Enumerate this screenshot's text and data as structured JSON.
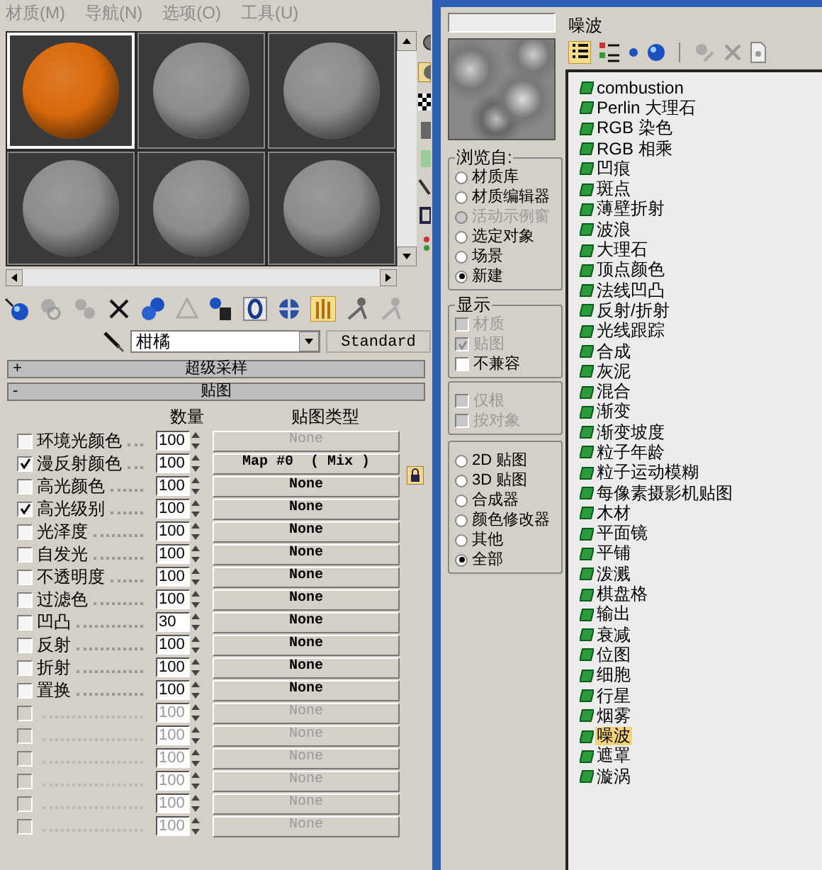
{
  "menu": [
    {
      "label": "材质(M)"
    },
    {
      "label": "导航(N)"
    },
    {
      "label": "选项(O)"
    },
    {
      "label": "工具(U)"
    }
  ],
  "sample_slots": [
    {
      "selected": true,
      "color": "#d8690c"
    },
    {
      "selected": false,
      "color": "#8c8c8c"
    },
    {
      "selected": false,
      "color": "#8c8c8c"
    },
    {
      "selected": false,
      "color": "#8c8c8c"
    },
    {
      "selected": false,
      "color": "#8c8c8c"
    },
    {
      "selected": false,
      "color": "#8c8c8c"
    }
  ],
  "material": {
    "name": "柑橘",
    "type": "Standard"
  },
  "rollouts": [
    {
      "sign": "+",
      "title": "超级采样"
    },
    {
      "sign": "-",
      "title": "贴图"
    }
  ],
  "maps": {
    "columns": [
      "数量",
      "贴图类型"
    ],
    "rows": [
      {
        "label": "环境光颜色",
        "checked": false,
        "disabled": false,
        "amount": "100",
        "map": "None",
        "map_disabled": true
      },
      {
        "label": "漫反射颜色",
        "checked": true,
        "disabled": false,
        "amount": "100",
        "map": "Map #0  ( Mix )",
        "map_disabled": false
      },
      {
        "label": "高光颜色",
        "checked": false,
        "disabled": false,
        "amount": "100",
        "map": "None",
        "map_disabled": false
      },
      {
        "label": "高光级别",
        "checked": true,
        "disabled": false,
        "amount": "100",
        "map": "None",
        "map_disabled": false
      },
      {
        "label": "光泽度",
        "checked": false,
        "disabled": false,
        "amount": "100",
        "map": "None",
        "map_disabled": false
      },
      {
        "label": "自发光",
        "checked": false,
        "disabled": false,
        "amount": "100",
        "map": "None",
        "map_disabled": false
      },
      {
        "label": "不透明度",
        "checked": false,
        "disabled": false,
        "amount": "100",
        "map": "None",
        "map_disabled": false
      },
      {
        "label": "过滤色",
        "checked": false,
        "disabled": false,
        "amount": "100",
        "map": "None",
        "map_disabled": false
      },
      {
        "label": "凹凸",
        "checked": false,
        "disabled": false,
        "amount": "30",
        "map": "None",
        "map_disabled": false
      },
      {
        "label": "反射",
        "checked": false,
        "disabled": false,
        "amount": "100",
        "map": "None",
        "map_disabled": false
      },
      {
        "label": "折射",
        "checked": false,
        "disabled": false,
        "amount": "100",
        "map": "None",
        "map_disabled": false
      },
      {
        "label": "置换",
        "checked": false,
        "disabled": false,
        "amount": "100",
        "map": "None",
        "map_disabled": false
      },
      {
        "checked": false,
        "disabled": true,
        "amount": "100",
        "map": "None",
        "map_disabled": true
      },
      {
        "checked": false,
        "disabled": true,
        "amount": "100",
        "map": "None",
        "map_disabled": true
      },
      {
        "checked": false,
        "disabled": true,
        "amount": "100",
        "map": "None",
        "map_disabled": true
      },
      {
        "checked": false,
        "disabled": true,
        "amount": "100",
        "map": "None",
        "map_disabled": true
      },
      {
        "checked": false,
        "disabled": true,
        "amount": "100",
        "map": "None",
        "map_disabled": true
      },
      {
        "checked": false,
        "disabled": true,
        "amount": "100",
        "map": "None",
        "map_disabled": true
      }
    ]
  },
  "browser": {
    "title": "噪波",
    "browse_from": {
      "title": "浏览自:",
      "options": [
        {
          "label": "材质库",
          "selected": false,
          "disabled": false
        },
        {
          "label": "材质编辑器",
          "selected": false,
          "disabled": false
        },
        {
          "label": "活动示例窗",
          "selected": false,
          "disabled": true
        },
        {
          "label": "选定对象",
          "selected": false,
          "disabled": false
        },
        {
          "label": "场景",
          "selected": false,
          "disabled": false
        },
        {
          "label": "新建",
          "selected": true,
          "disabled": false
        }
      ]
    },
    "show": {
      "title": "显示",
      "options": [
        {
          "label": "材质",
          "checked": false,
          "disabled": true
        },
        {
          "label": "贴图",
          "checked": true,
          "disabled": true
        },
        {
          "label": "不兼容",
          "checked": false,
          "disabled": false
        }
      ]
    },
    "filters": [
      {
        "label": "仅根",
        "checked": false,
        "disabled": true
      },
      {
        "label": "按对象",
        "checked": false,
        "disabled": true
      }
    ],
    "categories": [
      {
        "label": "2D 贴图",
        "selected": false
      },
      {
        "label": "3D 贴图",
        "selected": false
      },
      {
        "label": "合成器",
        "selected": false
      },
      {
        "label": "颜色修改器",
        "selected": false
      },
      {
        "label": "其他",
        "selected": false
      },
      {
        "label": "全部",
        "selected": true
      }
    ],
    "items": [
      {
        "label": "combustion",
        "selected": false
      },
      {
        "label": "Perlin 大理石",
        "selected": false
      },
      {
        "label": "RGB 染色",
        "selected": false
      },
      {
        "label": "RGB 相乘",
        "selected": false
      },
      {
        "label": "凹痕",
        "selected": false
      },
      {
        "label": "斑点",
        "selected": false
      },
      {
        "label": "薄壁折射",
        "selected": false
      },
      {
        "label": "波浪",
        "selected": false
      },
      {
        "label": "大理石",
        "selected": false
      },
      {
        "label": "顶点颜色",
        "selected": false
      },
      {
        "label": "法线凹凸",
        "selected": false
      },
      {
        "label": "反射/折射",
        "selected": false
      },
      {
        "label": "光线跟踪",
        "selected": false
      },
      {
        "label": "合成",
        "selected": false
      },
      {
        "label": "灰泥",
        "selected": false
      },
      {
        "label": "混合",
        "selected": false
      },
      {
        "label": "渐变",
        "selected": false
      },
      {
        "label": "渐变坡度",
        "selected": false
      },
      {
        "label": "粒子年龄",
        "selected": false
      },
      {
        "label": "粒子运动模糊",
        "selected": false
      },
      {
        "label": "每像素摄影机贴图",
        "selected": false
      },
      {
        "label": "木材",
        "selected": false
      },
      {
        "label": "平面镜",
        "selected": false
      },
      {
        "label": "平铺",
        "selected": false
      },
      {
        "label": "泼溅",
        "selected": false
      },
      {
        "label": "棋盘格",
        "selected": false
      },
      {
        "label": "输出",
        "selected": false
      },
      {
        "label": "衰减",
        "selected": false
      },
      {
        "label": "位图",
        "selected": false
      },
      {
        "label": "细胞",
        "selected": false
      },
      {
        "label": "行星",
        "selected": false
      },
      {
        "label": "烟雾",
        "selected": false
      },
      {
        "label": "噪波",
        "selected": true
      },
      {
        "label": "遮罩",
        "selected": false
      },
      {
        "label": "漩涡",
        "selected": false
      }
    ]
  }
}
